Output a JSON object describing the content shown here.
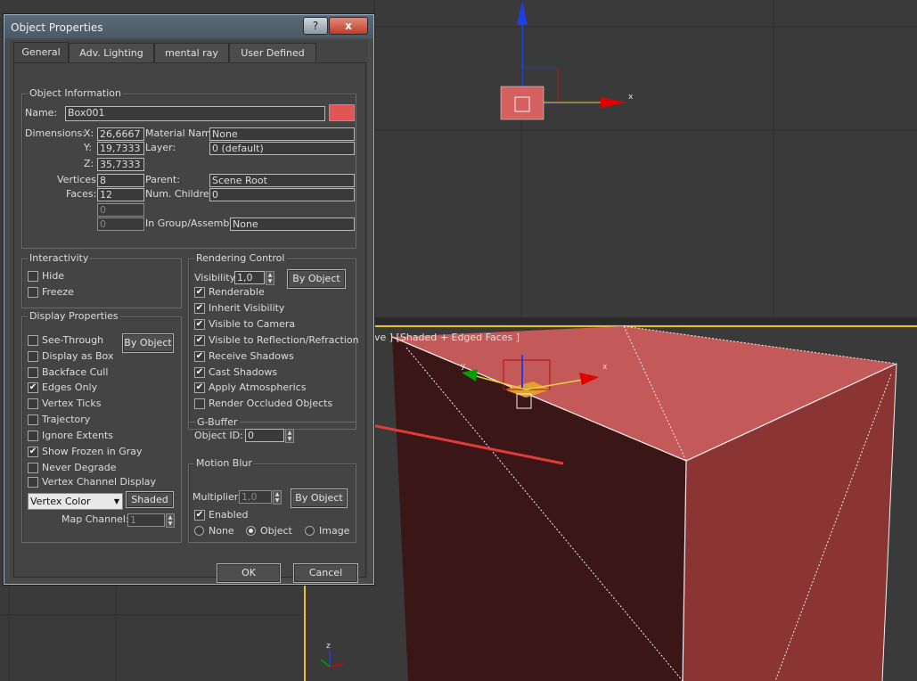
{
  "dialog": {
    "title": "Object Properties",
    "help_label": "?",
    "close_label": "x",
    "tabs": [
      {
        "label": "General"
      },
      {
        "label": "Adv. Lighting"
      },
      {
        "label": "mental ray"
      },
      {
        "label": "User Defined"
      }
    ]
  },
  "object_info": {
    "group_title": "Object Information",
    "name_label": "Name:",
    "name_value": "Box001",
    "color_swatch": "#e05555",
    "dimensions_label": "Dimensions:",
    "x_label": "X:",
    "x_value": "26,6667",
    "y_label": "Y:",
    "y_value": "19,7333",
    "z_label": "Z:",
    "z_value": "35,7333",
    "vertices_label": "Vertices:",
    "vertices_value": "8",
    "faces_label": "Faces:",
    "faces_value": "12",
    "extra1_value": "0",
    "extra2_value": "0",
    "material_label": "Material Name:",
    "material_value": "None",
    "layer_label": "Layer:",
    "layer_value": "0 (default)",
    "parent_label": "Parent:",
    "parent_value": "Scene Root",
    "children_label": "Num. Children:",
    "children_value": "0",
    "group_label": "In Group/Assembly:",
    "group_value": "None"
  },
  "interactivity": {
    "group_title": "Interactivity",
    "hide_label": "Hide",
    "freeze_label": "Freeze"
  },
  "display": {
    "group_title": "Display Properties",
    "by_object_label": "By Object",
    "items": [
      {
        "label": "See-Through",
        "checked": false
      },
      {
        "label": "Display as Box",
        "checked": false
      },
      {
        "label": "Backface Cull",
        "checked": false
      },
      {
        "label": "Edges Only",
        "checked": true
      },
      {
        "label": "Vertex Ticks",
        "checked": false
      },
      {
        "label": "Trajectory",
        "checked": false
      },
      {
        "label": "Ignore Extents",
        "checked": false
      },
      {
        "label": "Show Frozen in Gray",
        "checked": true
      },
      {
        "label": "Never Degrade",
        "checked": false
      },
      {
        "label": "Vertex Channel Display",
        "checked": false
      }
    ],
    "vertex_color_value": "Vertex Color",
    "shaded_label": "Shaded",
    "map_channel_label": "Map Channel:",
    "map_channel_value": "1"
  },
  "rendering": {
    "group_title": "Rendering Control",
    "visibility_label": "Visibility:",
    "visibility_value": "1,0",
    "by_object_label": "By Object",
    "items": [
      {
        "label": "Renderable",
        "checked": true
      },
      {
        "label": "Inherit Visibility",
        "checked": true
      },
      {
        "label": "Visible to Camera",
        "checked": true
      },
      {
        "label": "Visible to Reflection/Refraction",
        "checked": true
      },
      {
        "label": "Receive Shadows",
        "checked": true
      },
      {
        "label": "Cast Shadows",
        "checked": true
      },
      {
        "label": "Apply Atmospherics",
        "checked": true
      },
      {
        "label": "Render Occluded Objects",
        "checked": false
      }
    ],
    "gbuffer_title": "G-Buffer",
    "object_id_label": "Object ID:",
    "object_id_value": "0"
  },
  "motion_blur": {
    "group_title": "Motion Blur",
    "multiplier_label": "Multiplier:",
    "multiplier_value": "1,0",
    "by_object_label": "By Object",
    "enabled_label": "Enabled",
    "none_label": "None",
    "object_label": "Object",
    "image_label": "Image"
  },
  "footer": {
    "ok_label": "OK",
    "cancel_label": "Cancel"
  },
  "viewport": {
    "label": "ve ] [Shaded + Edged Faces ]",
    "axis_x": "x",
    "axis_y": "y",
    "axis_z": "z"
  },
  "colors": {
    "box_face": "#c55a5a",
    "box_dark": "#3c1616",
    "gizmo_x": "#e00000",
    "gizmo_y": "#00a000",
    "gizmo_z": "#1f3fe0",
    "annotation_arrow": "#e03a3a",
    "viewport_border": "#e8c030"
  }
}
